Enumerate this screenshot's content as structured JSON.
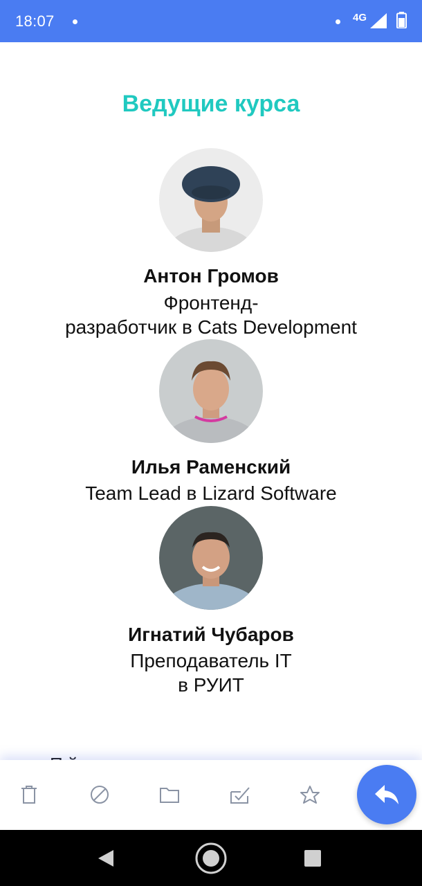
{
  "status_bar": {
    "time": "18:07",
    "network": "4G",
    "icons": [
      "notification-dot-icon",
      "signal-icon",
      "battery-icon"
    ]
  },
  "section": {
    "title": "Ведущие курса"
  },
  "speakers": [
    {
      "name": "Антон Громов",
      "role_line1": "Фронтенд-",
      "role_line2": "разработчик в Cats Development"
    },
    {
      "name": "Илья Раменский",
      "role_line1": "Team Lead в Lizard Software"
    },
    {
      "name": "Игнатий Чубаров",
      "role_line1": "Преподаватель IT",
      "role_line2": "в РУИТ"
    }
  ],
  "partial_text": "П                  й",
  "toolbar": {
    "icons": [
      "trash-icon",
      "block-icon",
      "folder-icon",
      "mark-done-icon",
      "star-icon"
    ],
    "fab_icon": "reply-icon"
  },
  "colors": {
    "accent": "#4a7cf2",
    "title": "#20c9c0"
  },
  "navigation": {
    "icons": [
      "back-icon",
      "home-icon",
      "recents-icon"
    ]
  }
}
